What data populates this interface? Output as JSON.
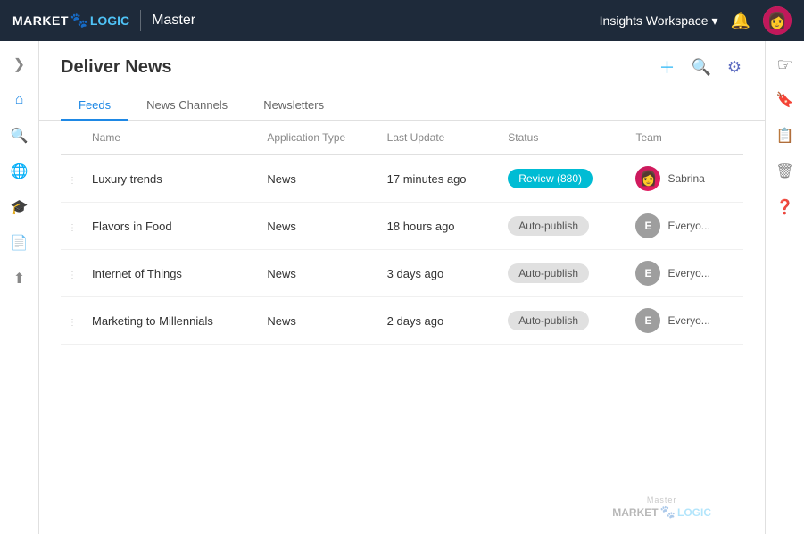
{
  "topNav": {
    "logoMarket": "MARKET",
    "logoLogic": "LOGIC",
    "master": "Master",
    "workspace": "Insights Workspace",
    "workspaceArrow": "▾"
  },
  "page": {
    "title": "Deliver News",
    "tabs": [
      {
        "id": "feeds",
        "label": "Feeds",
        "active": true
      },
      {
        "id": "news-channels",
        "label": "News Channels",
        "active": false
      },
      {
        "id": "newsletters",
        "label": "Newsletters",
        "active": false
      }
    ]
  },
  "table": {
    "columns": [
      {
        "id": "drag",
        "label": ""
      },
      {
        "id": "name",
        "label": "Name"
      },
      {
        "id": "app-type",
        "label": "Application Type"
      },
      {
        "id": "last-update",
        "label": "Last Update"
      },
      {
        "id": "status",
        "label": "Status"
      },
      {
        "id": "team",
        "label": "Team"
      }
    ],
    "rows": [
      {
        "id": 1,
        "name": "Luxury trends",
        "appType": "News",
        "lastUpdate": "17 minutes ago",
        "status": "Review (880)",
        "statusType": "review",
        "teamAvatar": "sabrina",
        "teamName": "Sabrina"
      },
      {
        "id": 2,
        "name": "Flavors in Food",
        "appType": "News",
        "lastUpdate": "18 hours ago",
        "status": "Auto-publish",
        "statusType": "auto",
        "teamAvatar": "everyone",
        "teamName": "Everyo..."
      },
      {
        "id": 3,
        "name": "Internet of Things",
        "appType": "News",
        "lastUpdate": "3 days ago",
        "status": "Auto-publish",
        "statusType": "auto",
        "teamAvatar": "everyone",
        "teamName": "Everyo..."
      },
      {
        "id": 4,
        "name": "Marketing to Millennials",
        "appType": "News",
        "lastUpdate": "2 days ago",
        "status": "Auto-publish",
        "statusType": "auto",
        "teamAvatar": "everyone",
        "teamName": "Everyo..."
      }
    ]
  },
  "sidebar": {
    "icons": [
      {
        "name": "chevron-right",
        "symbol": "❯"
      },
      {
        "name": "home",
        "symbol": "⌂"
      },
      {
        "name": "search",
        "symbol": "🔍"
      },
      {
        "name": "globe",
        "symbol": "🌐"
      },
      {
        "name": "graduation",
        "symbol": "🎓"
      },
      {
        "name": "document",
        "symbol": "📄"
      },
      {
        "name": "upload",
        "symbol": "⬆"
      }
    ]
  },
  "rightSidebar": {
    "icons": [
      {
        "name": "cursor-hand",
        "symbol": "☞"
      },
      {
        "name": "bookmark",
        "symbol": "🔖"
      },
      {
        "name": "clipboard-check",
        "symbol": "📋"
      },
      {
        "name": "trash",
        "symbol": "🗑"
      },
      {
        "name": "help",
        "symbol": "❓"
      }
    ]
  },
  "watermark": {
    "master": "Master",
    "market": "MARKET",
    "logic": "LOGIC"
  }
}
